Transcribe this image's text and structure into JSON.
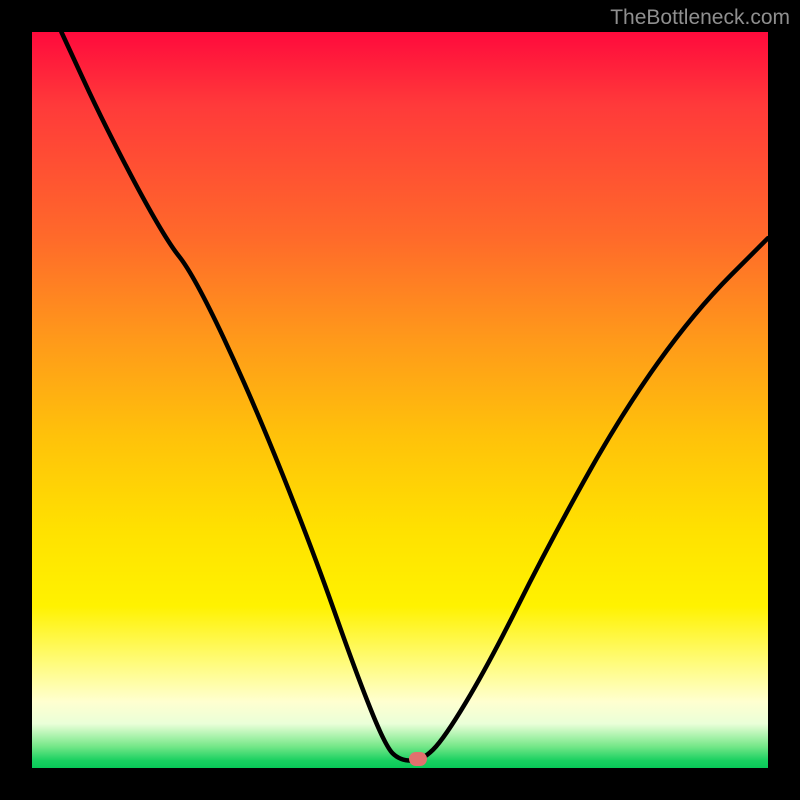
{
  "watermark": "TheBottleneck.com",
  "marker": {
    "x_pct": 52.5,
    "y_pct": 98.8
  },
  "chart_data": {
    "type": "line",
    "title": "",
    "xlabel": "",
    "ylabel": "",
    "xlim": [
      0,
      100
    ],
    "ylim": [
      0,
      100
    ],
    "series": [
      {
        "name": "bottleneck-curve",
        "x": [
          4,
          10,
          18,
          22,
          30,
          38,
          44,
          48,
          50,
          53,
          56,
          62,
          70,
          80,
          90,
          100
        ],
        "y": [
          100,
          87,
          72,
          67,
          50,
          30,
          13,
          3,
          1,
          1,
          4,
          14,
          30,
          48,
          62,
          72
        ]
      }
    ],
    "marker_point": {
      "x": 52.5,
      "y": 1.2
    },
    "background_gradient": {
      "type": "vertical-linear",
      "stops": [
        {
          "pct": 0,
          "color": "#ff0a3c"
        },
        {
          "pct": 28,
          "color": "#ff6a2a"
        },
        {
          "pct": 55,
          "color": "#ffc20a"
        },
        {
          "pct": 78,
          "color": "#fff200"
        },
        {
          "pct": 94,
          "color": "#eaffd8"
        },
        {
          "pct": 100,
          "color": "#08c858"
        }
      ]
    }
  }
}
